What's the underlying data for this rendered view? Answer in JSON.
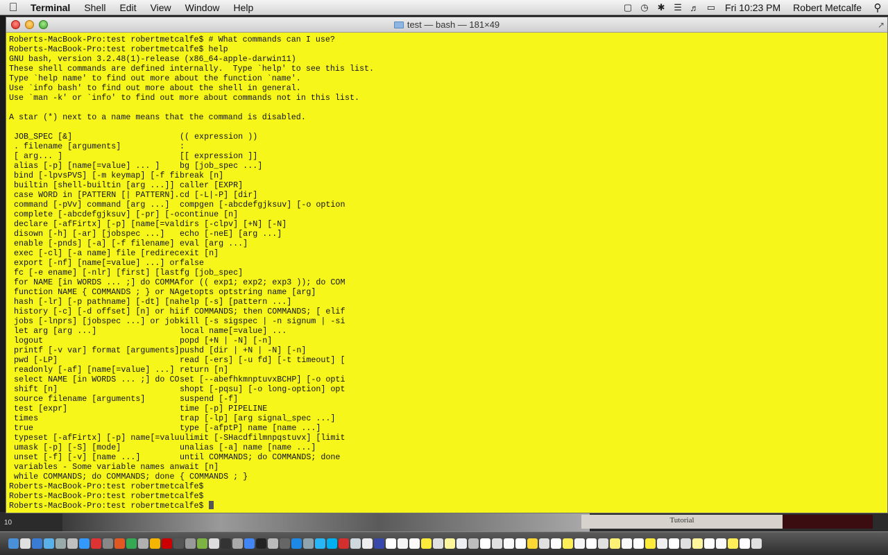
{
  "menubar": {
    "app_name": "Terminal",
    "items": [
      "Shell",
      "Edit",
      "View",
      "Window",
      "Help"
    ],
    "clock": "Fri 10:23 PM",
    "user": "Robert Metcalfe",
    "status_icons": [
      "dropbox-icon",
      "time-machine-icon",
      "bluetooth-icon",
      "wifi-icon",
      "volume-icon",
      "battery-icon"
    ]
  },
  "window": {
    "title": "test — bash — 181×49",
    "background_color": "#f6f61a"
  },
  "desktop": {
    "panel_label": "Tutorial",
    "corner_label": "10"
  },
  "terminal": {
    "intro_lines": [
      "Roberts-MacBook-Pro:test robertmetcalfe$ # What commands can I use?",
      "Roberts-MacBook-Pro:test robertmetcalfe$ help",
      "GNU bash, version 3.2.48(1)-release (x86_64-apple-darwin11)",
      "These shell commands are defined internally.  Type `help' to see this list.",
      "Type `help name' to find out more about the function `name'.",
      "Use `info bash' to find out more about the shell in general.",
      "Use `man -k' or `info' to find out more about commands not in this list.",
      "",
      "A star (*) next to a name means that the command is disabled.",
      ""
    ],
    "commands": [
      [
        " JOB_SPEC [&]",
        "(( expression ))"
      ],
      [
        " . filename [arguments]",
        ":"
      ],
      [
        " [ arg... ]",
        "[[ expression ]]"
      ],
      [
        " alias [-p] [name[=value] ... ]",
        "bg [job_spec ...]"
      ],
      [
        " bind [-lpvsPVS] [-m keymap] [-f fi",
        "break [n]"
      ],
      [
        " builtin [shell-builtin [arg ...]]",
        "caller [EXPR]"
      ],
      [
        " case WORD in [PATTERN [| PATTERN].",
        "cd [-L|-P] [dir]"
      ],
      [
        " command [-pVv] command [arg ...]",
        "compgen [-abcdefgjksuv] [-o option"
      ],
      [
        " complete [-abcdefgjksuv] [-pr] [-o",
        "continue [n]"
      ],
      [
        " declare [-afFirtx] [-p] [name[=val",
        "dirs [-clpv] [+N] [-N]"
      ],
      [
        " disown [-h] [-ar] [jobspec ...]",
        "echo [-neE] [arg ...]"
      ],
      [
        " enable [-pnds] [-a] [-f filename]",
        "eval [arg ...]"
      ],
      [
        " exec [-cl] [-a name] file [redirec",
        "exit [n]"
      ],
      [
        " export [-nf] [name[=value] ...] or",
        "false"
      ],
      [
        " fc [-e ename] [-nlr] [first] [last",
        "fg [job_spec]"
      ],
      [
        " for NAME [in WORDS ... ;] do COMMA",
        "for (( exp1; exp2; exp3 )); do COM"
      ],
      [
        " function NAME { COMMANDS ; } or NA",
        "getopts optstring name [arg]"
      ],
      [
        " hash [-lr] [-p pathname] [-dt] [na",
        "help [-s] [pattern ...]"
      ],
      [
        " history [-c] [-d offset] [n] or hi",
        "if COMMANDS; then COMMANDS; [ elif"
      ],
      [
        " jobs [-lnprs] [jobspec ...] or job",
        "kill [-s sigspec | -n signum | -si"
      ],
      [
        " let arg [arg ...]",
        "local name[=value] ..."
      ],
      [
        " logout",
        "popd [+N | -N] [-n]"
      ],
      [
        " printf [-v var] format [arguments]",
        "pushd [dir | +N | -N] [-n]"
      ],
      [
        " pwd [-LP]",
        "read [-ers] [-u fd] [-t timeout] ["
      ],
      [
        " readonly [-af] [name[=value] ...]",
        "return [n]"
      ],
      [
        " select NAME [in WORDS ... ;] do CO",
        "set [--abefhkmnptuvxBCHP] [-o opti"
      ],
      [
        " shift [n]",
        "shopt [-pqsu] [-o long-option] opt"
      ],
      [
        " source filename [arguments]",
        "suspend [-f]"
      ],
      [
        " test [expr]",
        "time [-p] PIPELINE"
      ],
      [
        " times",
        "trap [-lp] [arg signal_spec ...]"
      ],
      [
        " true",
        "type [-afptP] name [name ...]"
      ],
      [
        " typeset [-afFirtx] [-p] name[=valu",
        "ulimit [-SHacdfilmnpqstuvx] [limit"
      ],
      [
        " umask [-p] [-S] [mode]",
        "unalias [-a] name [name ...]"
      ],
      [
        " unset [-f] [-v] [name ...]",
        "until COMMANDS; do COMMANDS; done"
      ],
      [
        " variables - Some variable names an",
        "wait [n]"
      ],
      [
        " while COMMANDS; do COMMANDS; done",
        "{ COMMANDS ; }"
      ]
    ],
    "prompt_lines": [
      "Roberts-MacBook-Pro:test robertmetcalfe$",
      "Roberts-MacBook-Pro:test robertmetcalfe$",
      "Roberts-MacBook-Pro:test robertmetcalfe$ "
    ]
  },
  "dock": {
    "icon_colors": [
      "#4a90d9",
      "#e0e0e0",
      "#3a7bd5",
      "#5ab0e8",
      "#9aa",
      "#c0c0c0",
      "#3399ff",
      "#d33",
      "#888",
      "#e25822",
      "#34a853",
      "#b0b0b0",
      "#f4b400",
      "#c00",
      "#555",
      "#999",
      "#7cb342",
      "#ddd",
      "#333",
      "#aaa",
      "#4285f4",
      "#222",
      "#bbb",
      "#666",
      "#1e88e5",
      "#90a4ae",
      "#29b6f6",
      "#00aff0",
      "#d32f2f",
      "#cfd8dc",
      "#eee",
      "#3949ab",
      "#fff",
      "#f5f5f5",
      "#fafafa",
      "#ffeb3b",
      "#e0e0e0",
      "#fff59d",
      "#eceff1",
      "#bdbdbd",
      "#fff",
      "#e0e0e0",
      "#fafafa",
      "#fff",
      "#fdd835",
      "#e0e0e0",
      "#fff",
      "#ffee58",
      "#f5f5f5",
      "#fff",
      "#e0e0e0",
      "#fff176",
      "#fafafa",
      "#fff",
      "#ffeb3b",
      "#f0f0f0",
      "#fff",
      "#e0e0e0",
      "#fff59d",
      "#fff",
      "#fafafa",
      "#ffee58",
      "#fff",
      "#e0e0e0"
    ]
  }
}
